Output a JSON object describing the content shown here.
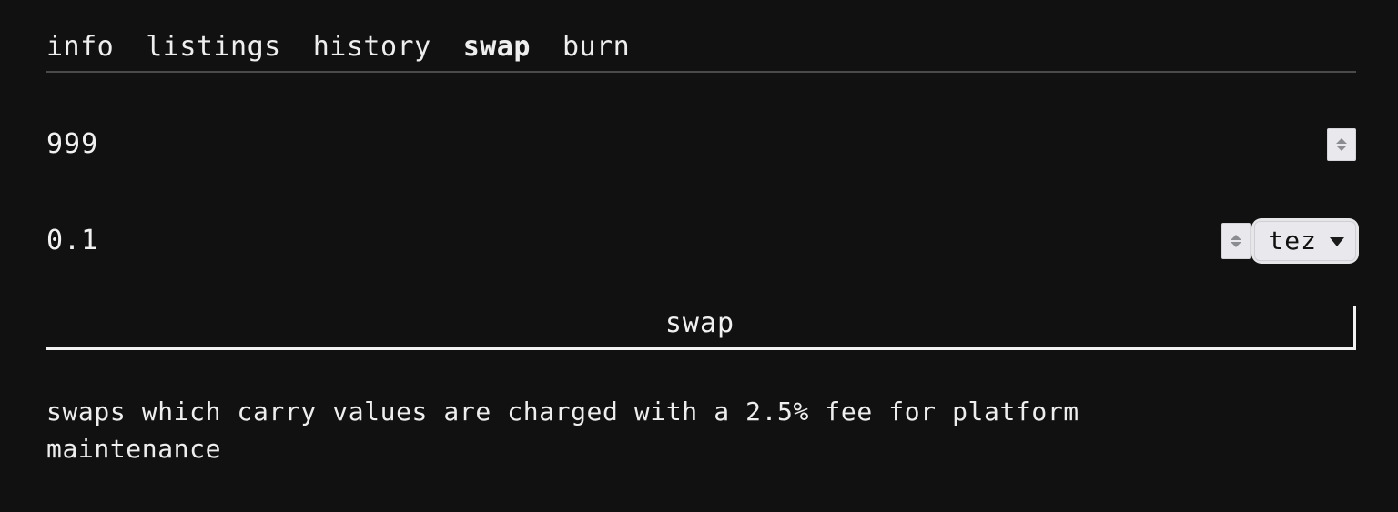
{
  "background_color": "#111111",
  "text_color": "#eeeeee",
  "control_bg_color": "#e8e8ed",
  "nav": {
    "items": [
      {
        "label": "info",
        "active": false
      },
      {
        "label": "listings",
        "active": false
      },
      {
        "label": "history",
        "active": false
      },
      {
        "label": "swap",
        "active": true
      },
      {
        "label": "burn",
        "active": false
      }
    ]
  },
  "form": {
    "amount": {
      "value": "999",
      "placeholder": "amount",
      "spinner_up_icon": "chevron-up-icon",
      "spinner_down_icon": "chevron-down-icon"
    },
    "price": {
      "value": "0.1",
      "placeholder": "price",
      "spinner_up_icon": "chevron-up-icon",
      "spinner_down_icon": "chevron-down-icon",
      "currency": {
        "selected": "tez",
        "options": [
          "tez"
        ],
        "caret_icon": "chevron-down-icon"
      }
    }
  },
  "actions": {
    "swap_label": "swap"
  },
  "note": {
    "text": "swaps which carry values are charged with a 2.5% fee for platform maintenance"
  }
}
